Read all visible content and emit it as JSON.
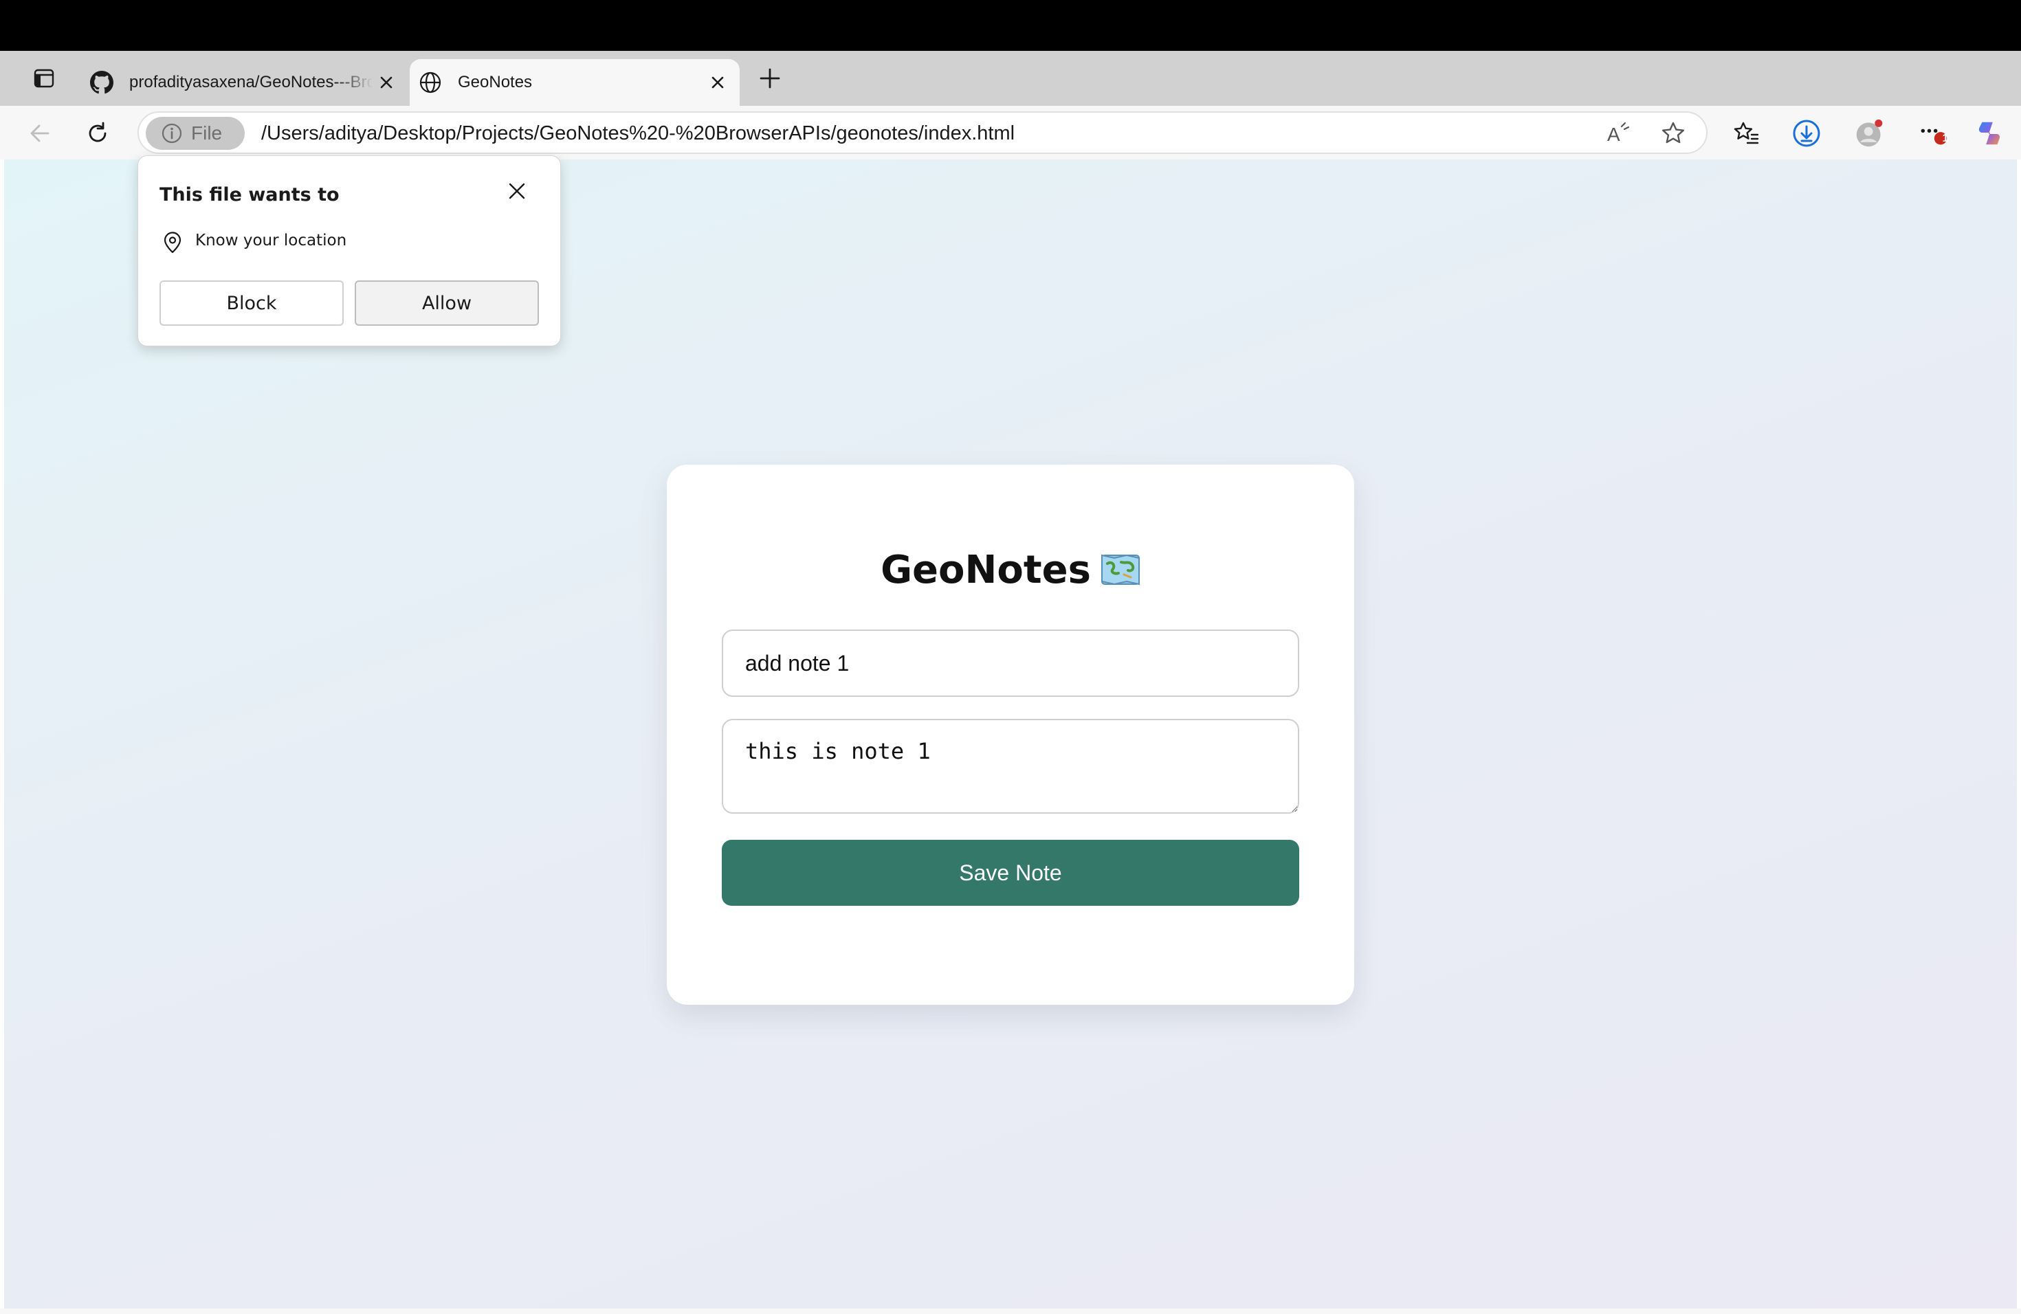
{
  "browser": {
    "tabs": [
      {
        "title": "profadityasaxena/GeoNotes---BrowserAPIs",
        "favicon": "github-icon",
        "active": false
      },
      {
        "title": "GeoNotes",
        "favicon": "globe-icon",
        "active": true
      }
    ],
    "address_bar": {
      "scheme_chip": "File",
      "url": "/Users/aditya/Desktop/Projects/GeoNotes%20-%20BrowserAPIs/geonotes/index.html"
    },
    "toolbar_icons": [
      "back-icon",
      "refresh-icon",
      "read-aloud-icon",
      "favorite-star-icon",
      "favorites-icon",
      "download-icon",
      "profile-icon",
      "more-icon",
      "copilot-icon"
    ],
    "notification_badge": "1",
    "colors": {
      "download": "#1b6fd8",
      "badge": "#c42b1c",
      "profile_dot": "#d13438"
    }
  },
  "permission_popup": {
    "title": "This file wants to",
    "permission": "Know your location",
    "block_label": "Block",
    "allow_label": "Allow"
  },
  "app": {
    "title": "GeoNotes",
    "title_emoji": "map-icon",
    "title_input_value": "add note 1",
    "body_input_value": "this is note 1",
    "save_label": "Save Note",
    "accent_color": "#34786a"
  }
}
